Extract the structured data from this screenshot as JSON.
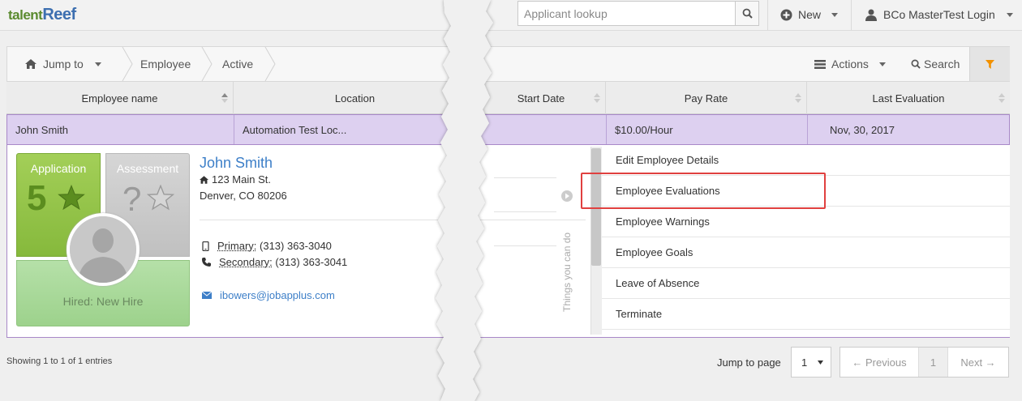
{
  "app": {
    "logo_part1": "talent",
    "logo_part2": "Reef"
  },
  "topbar": {
    "search_placeholder": "Applicant lookup",
    "new_label": "New",
    "user_label": "BCo MasterTest Login"
  },
  "toolbar": {
    "jump_to": "Jump to",
    "breadcrumb": [
      "Employee",
      "Active"
    ],
    "actions_label": "Actions",
    "search_label": "Search"
  },
  "table": {
    "columns": [
      "Employee name",
      "Location",
      "Start Date",
      "Pay Rate",
      "Last Evaluation"
    ],
    "row": {
      "name": "John Smith",
      "location": "Automation Test Loc...",
      "start_date": "",
      "pay_rate": "$10.00/Hour",
      "last_evaluation": "Nov, 30, 2017"
    }
  },
  "detail": {
    "application_label": "Application",
    "application_score": "5",
    "assessment_label": "Assessment",
    "assessment_score": "?",
    "hired_label": "Hired: New Hire",
    "name": "John Smith",
    "address_line1": "123 Main St.",
    "address_line2": "Denver, CO 80206",
    "primary_label": "Primary:",
    "primary_phone": "(313) 363-3040",
    "secondary_label": "Secondary:",
    "secondary_phone": "(313) 363-3041",
    "email": "ibowers@jobapplus.com",
    "things_label": "Things you can do",
    "actions": [
      "Edit Employee Details",
      "Employee Evaluations",
      "Employee Warnings",
      "Employee Goals",
      "Leave of Absence",
      "Terminate"
    ]
  },
  "footer": {
    "showing": "Showing 1 to 1 of 1 entries",
    "jump_label": "Jump to page",
    "jump_value": "1",
    "prev_label": "← Previous",
    "page": "1",
    "next_label": "Next →"
  },
  "colors": {
    "accent_blue": "#3d7fc8",
    "row_selected": "#ddd0f0",
    "highlight_red": "#e0403f",
    "filter_orange": "#f29100"
  }
}
